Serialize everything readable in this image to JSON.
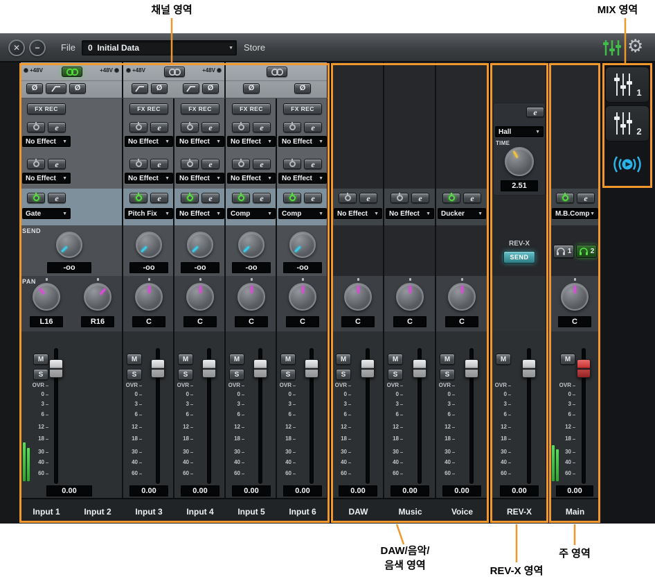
{
  "annotations": {
    "channel_area": "채널 영역",
    "mix_area": "MIX 영역",
    "daw_area_line1": "DAW/음악/",
    "daw_area_line2": "음색 영역",
    "revx_area": "REV-X 영역",
    "main_area": "주 영역"
  },
  "titlebar": {
    "file_label": "File",
    "file_value": "0  Initial Data",
    "store_label": "Store"
  },
  "icons": {
    "close": "✕",
    "minimize": "−",
    "caret": "▼",
    "gear": "⚙"
  },
  "labels": {
    "send": "SEND",
    "pan": "PAN",
    "phantom": "+48V",
    "fx_rec": "FX REC",
    "mute": "M",
    "solo": "S",
    "edit": "e",
    "phase": "Ø"
  },
  "meter_ticks": [
    "OVR",
    "0",
    "3",
    "6",
    "12",
    "18",
    "30",
    "40",
    "60"
  ],
  "send_knob_angle": -135,
  "input_headers": [
    {
      "phantom": true,
      "linked": true,
      "hpf_buttons": [
        "phase",
        "hpf",
        "phase"
      ]
    },
    {
      "phantom": true,
      "linked": false,
      "hpf_buttons": [
        "hpf",
        "phase",
        "hpf",
        "phase"
      ]
    },
    {
      "phantom": false,
      "linked": false,
      "hpf_buttons": [
        "phase",
        "phase"
      ]
    }
  ],
  "strips": [
    {
      "kind": "pair",
      "names": [
        "Input 1",
        "Input 2"
      ],
      "fx_rec": true,
      "fx1": "No Effect",
      "fx2": "No Effect",
      "insert": "Gate",
      "insert_on": true,
      "send": "-oo",
      "pans": [
        {
          "value": "L16",
          "angle": -42
        },
        {
          "value": "R16",
          "angle": 42
        }
      ],
      "fader_value": "0.00",
      "has_meter": true
    },
    {
      "kind": "input",
      "names": [
        "Input 3"
      ],
      "fx_rec": true,
      "fx1": "No Effect",
      "fx2": "No Effect",
      "insert": "Pitch Fix",
      "insert_on": true,
      "send": "-oo",
      "pans": [
        {
          "value": "C",
          "angle": 0
        }
      ],
      "fader_value": "0.00"
    },
    {
      "kind": "input",
      "names": [
        "Input 4"
      ],
      "fx_rec": true,
      "fx1": "No Effect",
      "fx2": "No Effect",
      "insert": "No Effect",
      "insert_on": true,
      "send": "-oo",
      "pans": [
        {
          "value": "C",
          "angle": 0
        }
      ],
      "fader_value": "0.00"
    },
    {
      "kind": "input",
      "names": [
        "Input 5"
      ],
      "fx_rec": true,
      "fx1": "No Effect",
      "fx2": "No Effect",
      "insert": "Comp",
      "insert_on": true,
      "send": "-oo",
      "pans": [
        {
          "value": "C",
          "angle": 0
        }
      ],
      "fader_value": "0.00"
    },
    {
      "kind": "input",
      "names": [
        "Input 6"
      ],
      "fx_rec": true,
      "fx1": "No Effect",
      "fx2": "No Effect",
      "insert": "Comp",
      "insert_on": true,
      "send": "-oo",
      "pans": [
        {
          "value": "C",
          "angle": 0
        }
      ],
      "fader_value": "0.00"
    },
    {
      "kind": "bus",
      "names": [
        "DAW"
      ],
      "insert": "No Effect",
      "insert_on": false,
      "pans": [
        {
          "value": "C",
          "angle": 0
        }
      ],
      "fader_value": "0.00"
    },
    {
      "kind": "bus",
      "names": [
        "Music"
      ],
      "insert": "No Effect",
      "insert_on": false,
      "pans": [
        {
          "value": "C",
          "angle": 0
        }
      ],
      "fader_value": "0.00"
    },
    {
      "kind": "bus",
      "names": [
        "Voice"
      ],
      "insert": "Ducker",
      "insert_on": true,
      "pans": [
        {
          "value": "C",
          "angle": 0
        }
      ],
      "fader_value": "0.00"
    },
    {
      "kind": "revx",
      "names": [
        "REV-X"
      ],
      "fader_value": "0.00"
    },
    {
      "kind": "main",
      "names": [
        "Main"
      ],
      "insert": "M.B.Comp",
      "insert_on": true,
      "pans": [
        {
          "value": "C",
          "angle": 0
        }
      ],
      "fader_value": "0.00",
      "has_meter": true
    }
  ],
  "revx_panel": {
    "type_value": "Hall",
    "time_label": "TIME",
    "time_value": "2.51",
    "send_label": "REV-X",
    "send_button": "SEND",
    "knob_angle": -30
  },
  "main_panel": {
    "phones": [
      {
        "label": "1",
        "on": false
      },
      {
        "label": "2",
        "on": true
      }
    ]
  },
  "mix_section": {
    "tabs": [
      {
        "label": "1"
      },
      {
        "label": "2"
      }
    ]
  },
  "colors": {
    "callout": "#f0982e",
    "power_on": "#54e03e",
    "link_on": "#54e03e",
    "send_pointer": "#38cbe8",
    "pan_pointer": "#d44fd4",
    "time_pointer": "#eec043",
    "meter_green": "#3ecc3e",
    "main_fader_red": "#c83232",
    "mix_blue": "#2ab4e8"
  }
}
